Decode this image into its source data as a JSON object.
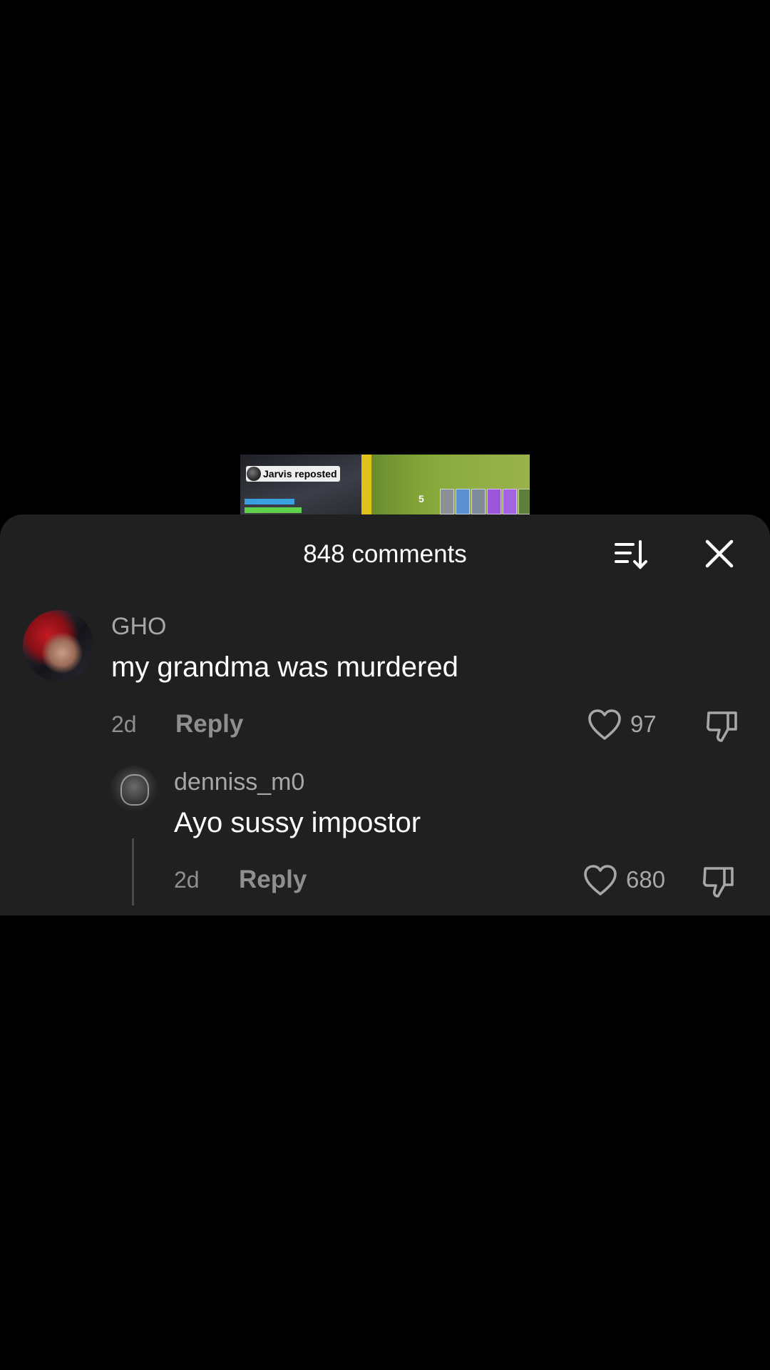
{
  "video": {
    "repost_label": "Jarvis reposted",
    "ammo_label": "5"
  },
  "comments_sheet": {
    "title": "848 comments",
    "sort_icon": "sort-icon",
    "close_icon": "close-icon"
  },
  "comments": [
    {
      "username": "GHO",
      "text": "my grandma was murdered",
      "time": "2d",
      "reply_label": "Reply",
      "likes": "97"
    }
  ],
  "replies": [
    {
      "username": "denniss_m0",
      "text": "Ayo sussy impostor",
      "time": "2d",
      "reply_label": "Reply",
      "likes": "680"
    }
  ],
  "colors": {
    "background": "#000000",
    "sheet": "#202021",
    "text_primary": "#ffffff",
    "text_secondary": "#a7a7a8",
    "text_muted": "#8f8f90"
  }
}
